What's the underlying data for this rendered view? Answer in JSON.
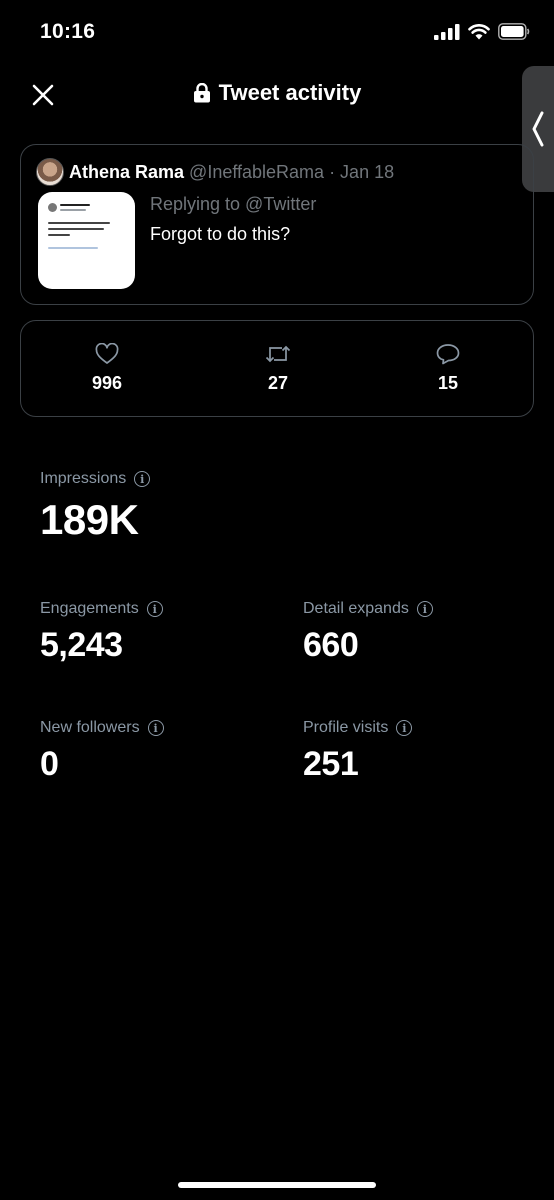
{
  "status_bar": {
    "time": "10:16"
  },
  "nav": {
    "title": "Tweet activity",
    "close_icon": "close-icon",
    "lock_icon": "lock-icon"
  },
  "tweet": {
    "author_name": "Athena Rama",
    "handle_date": "@IneffableRama · Jan 18",
    "reply_to": "Replying to @Twitter",
    "text": "Forgot to do this?"
  },
  "engagement": [
    {
      "icon": "heart-icon",
      "value": "996"
    },
    {
      "icon": "retweet-icon",
      "value": "27"
    },
    {
      "icon": "reply-icon",
      "value": "15"
    }
  ],
  "metrics": {
    "impressions": {
      "label": "Impressions",
      "value": "189K"
    },
    "engagements": {
      "label": "Engagements",
      "value": "5,243"
    },
    "detail_expands": {
      "label": "Detail expands",
      "value": "660"
    },
    "new_followers": {
      "label": "New followers",
      "value": "0"
    },
    "profile_visits": {
      "label": "Profile visits",
      "value": "251"
    }
  },
  "colors": {
    "background": "#000000",
    "border": "#3b4045",
    "muted": "#71767b",
    "text": "#ffffff"
  }
}
